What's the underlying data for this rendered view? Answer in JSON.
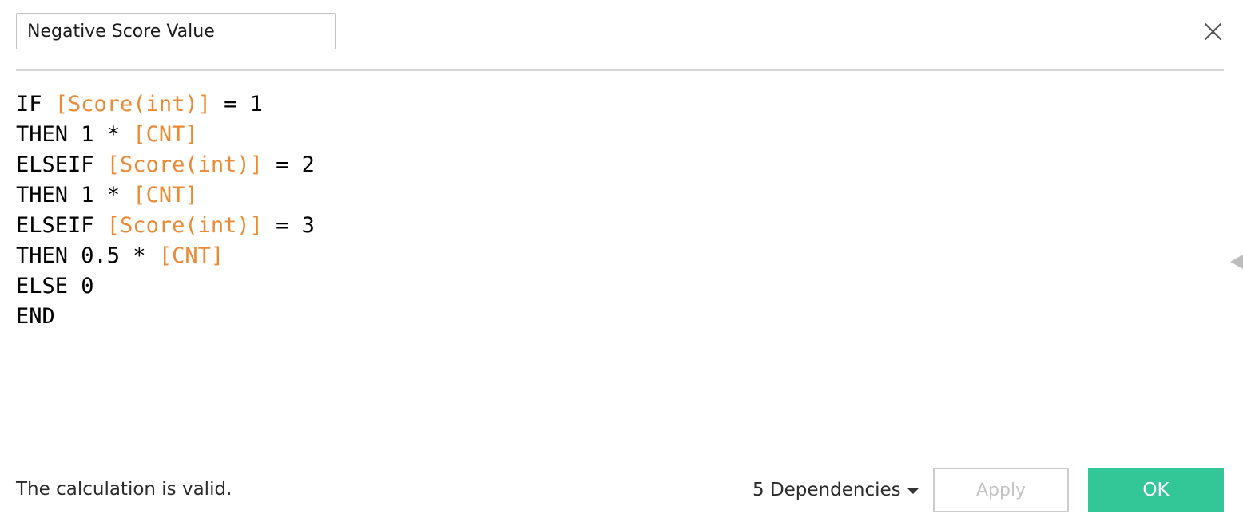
{
  "dialog": {
    "calculation_name": "Negative Score Value"
  },
  "editor": {
    "lines": [
      [
        {
          "t": "IF ",
          "k": "kw"
        },
        {
          "t": "[Score(int)]",
          "k": "field"
        },
        {
          "t": " = 1",
          "k": "kw"
        }
      ],
      [
        {
          "t": "THEN 1 * ",
          "k": "kw"
        },
        {
          "t": "[CNT]",
          "k": "field"
        }
      ],
      [
        {
          "t": "ELSEIF ",
          "k": "kw"
        },
        {
          "t": "[Score(int)]",
          "k": "field"
        },
        {
          "t": " = 2",
          "k": "kw"
        }
      ],
      [
        {
          "t": "THEN 1 * ",
          "k": "kw"
        },
        {
          "t": "[CNT]",
          "k": "field"
        }
      ],
      [
        {
          "t": "ELSEIF ",
          "k": "kw"
        },
        {
          "t": "[Score(int)]",
          "k": "field"
        },
        {
          "t": " = 3",
          "k": "kw"
        }
      ],
      [
        {
          "t": "THEN 0.5 * ",
          "k": "kw"
        },
        {
          "t": "[CNT]",
          "k": "field"
        }
      ],
      [
        {
          "t": "ELSE 0",
          "k": "kw"
        }
      ],
      [
        {
          "t": "END",
          "k": "kw"
        }
      ]
    ]
  },
  "footer": {
    "status": "The calculation is valid.",
    "dependencies_label": "5 Dependencies",
    "apply_label": "Apply",
    "ok_label": "OK"
  },
  "colors": {
    "field_reference": "#eb8a35",
    "ok_button": "#33c697",
    "divider": "#d6d6d6"
  },
  "icons": {
    "close": "close-icon",
    "dependencies_dropdown": "caret-down-icon",
    "side_panel_toggle": "triangle-left-icon"
  }
}
